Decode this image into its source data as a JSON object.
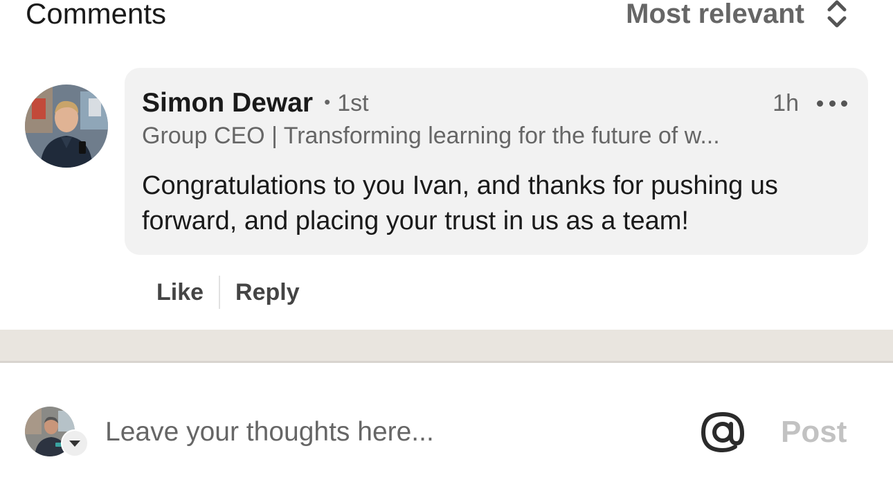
{
  "header": {
    "title": "Comments",
    "sort_label": "Most relevant",
    "sort_icon": "up-down-chevron-icon"
  },
  "comment": {
    "author_name": "Simon Dewar",
    "degree_separator": "•",
    "degree": "1st",
    "time": "1h",
    "more_icon": "more-horizontal-icon",
    "headline": "Group CEO | Transforming learning for the future of w...",
    "text": "Congratulations to you Ivan, and thanks for pushing us forward, and placing your trust in us as a team!",
    "actions": {
      "like": "Like",
      "reply": "Reply"
    }
  },
  "composer": {
    "placeholder": "Leave your thoughts here...",
    "mention_icon": "at-sign-icon",
    "post_label": "Post",
    "avatar_menu_icon": "caret-down-icon"
  },
  "colors": {
    "bubble": "#f2f2f2",
    "separator": "#e9e5df",
    "muted_text": "#666666",
    "post_disabled": "#c2c2c2"
  }
}
